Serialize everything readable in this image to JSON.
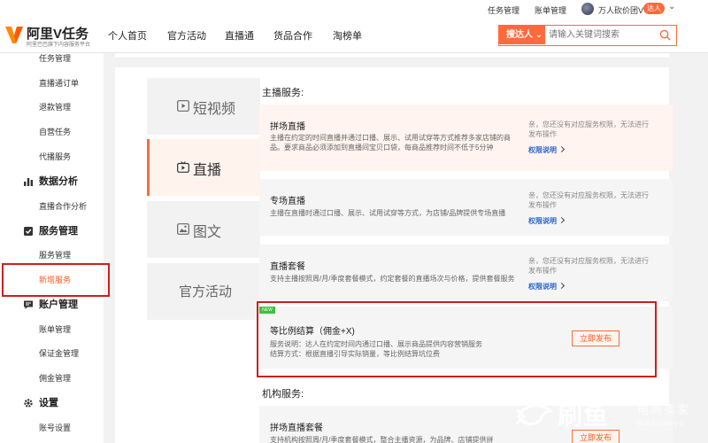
{
  "topbar": {
    "task_mgmt": "任务管理",
    "bill_mgmt": "账单管理",
    "username": "万人砍价团V",
    "role_badge": "达人"
  },
  "header": {
    "logo_name": "阿里V任务",
    "logo_slogan": "阿里巴巴旗下内容服务平台",
    "nav": [
      "个人首页",
      "官方活动",
      "直播通",
      "货品合作",
      "淘榜单"
    ],
    "search_type": "搜达人",
    "search_placeholder": "请输入关键词搜索"
  },
  "sidebar": {
    "items_top": [
      "任务管理",
      "直播通订单",
      "退款管理",
      "自营任务",
      "代播服务"
    ],
    "group_data": "数据分析",
    "items_data": [
      "直播合作分析"
    ],
    "group_service": "服务管理",
    "items_service": [
      "服务管理",
      "新增服务"
    ],
    "group_account": "账户管理",
    "items_account": [
      "账单管理",
      "保证金管理",
      "佣金管理"
    ],
    "group_settings": "设置",
    "items_settings": [
      "账号设置"
    ],
    "active_item": "新增服务"
  },
  "tabs": [
    "短视频",
    "直播",
    "图文",
    "官方活动"
  ],
  "active_tab": "直播",
  "anchor_section": {
    "title": "主播服务:",
    "cards": [
      {
        "title": "拼场直播",
        "desc": "主播在约定的时间直播并通过口播、展示、试用试穿等方式推荐多家店铺的商品。要求商品必须添加到直播间宝贝口袋，每商品推荐时间不低于5分钟",
        "no_perm": "亲，您还没有对应服务权限，无法进行发布操作",
        "perm_link": "权限说明"
      },
      {
        "title": "专场直播",
        "desc": "主播在直播时通过口播、展示、试用试穿等方式，为店铺/品牌提供专场直播",
        "no_perm": "亲，您还没有对应服务权限，无法进行发布操作",
        "perm_link": "权限说明"
      },
      {
        "title": "直播套餐",
        "desc": "支持主播按照周/月/季度套餐模式，约定套餐的直播场次与价格，提供套餐服务",
        "no_perm": "亲，您还没有对应服务权限，无法进行发布操作",
        "perm_link": "权限说明"
      },
      {
        "badge": "NEW",
        "title": "等比例结算（佣金+X)",
        "desc1": "服务说明：达人在约定时间内通过口播、展示商品提供内容营销服务",
        "desc2": "结算方式：根据直播引导实际销量，等比例结算坑位费",
        "button": "立即发布"
      }
    ]
  },
  "agency_section": {
    "title": "机构服务:",
    "cards": [
      {
        "title": "拼场直播套餐",
        "desc": "支持机构按照周/月/季度套餐模式，整合主播资源，为品牌、店铺提供拼",
        "button": "立即发布"
      }
    ]
  },
  "watermark": {
    "big": "刷鱼",
    "cn": "电商卖家",
    "py": "dianxiaoyu"
  },
  "colors": {
    "accent": "#ff6a3d",
    "highlight_box": "#cc1f1f",
    "link": "#2b66c9"
  }
}
